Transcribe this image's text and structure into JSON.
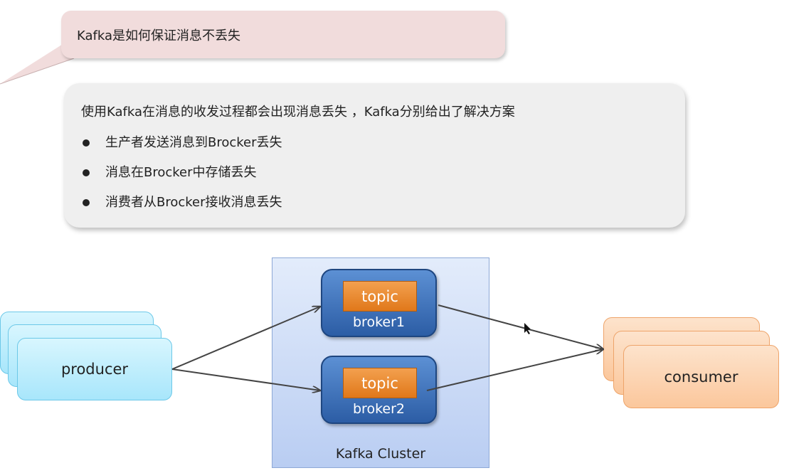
{
  "callout": {
    "text": "Kafka是如何保证消息不丢失"
  },
  "info": {
    "intro": "使用Kafka在消息的收发过程都会出现消息丢失 ，Kafka分别给出了解决方案",
    "bullets": [
      "生产者发送消息到Brocker丢失",
      "消息在Brocker中存储丢失",
      "消费者从Brocker接收消息丢失"
    ]
  },
  "diagram": {
    "producer": "producer",
    "consumer": "consumer",
    "cluster": "Kafka Cluster",
    "brokers": [
      {
        "topic": "topic",
        "name": "broker1"
      },
      {
        "topic": "topic",
        "name": "broker2"
      }
    ]
  },
  "colors": {
    "callout_bg": "#f1dcdc",
    "info_bg": "#efefef",
    "cluster_bg": "#c9d9f5",
    "broker": "#3a6fb8",
    "topic": "#ea8a2f",
    "producer": "#bfeefd",
    "consumer": "#fcd3b0"
  }
}
